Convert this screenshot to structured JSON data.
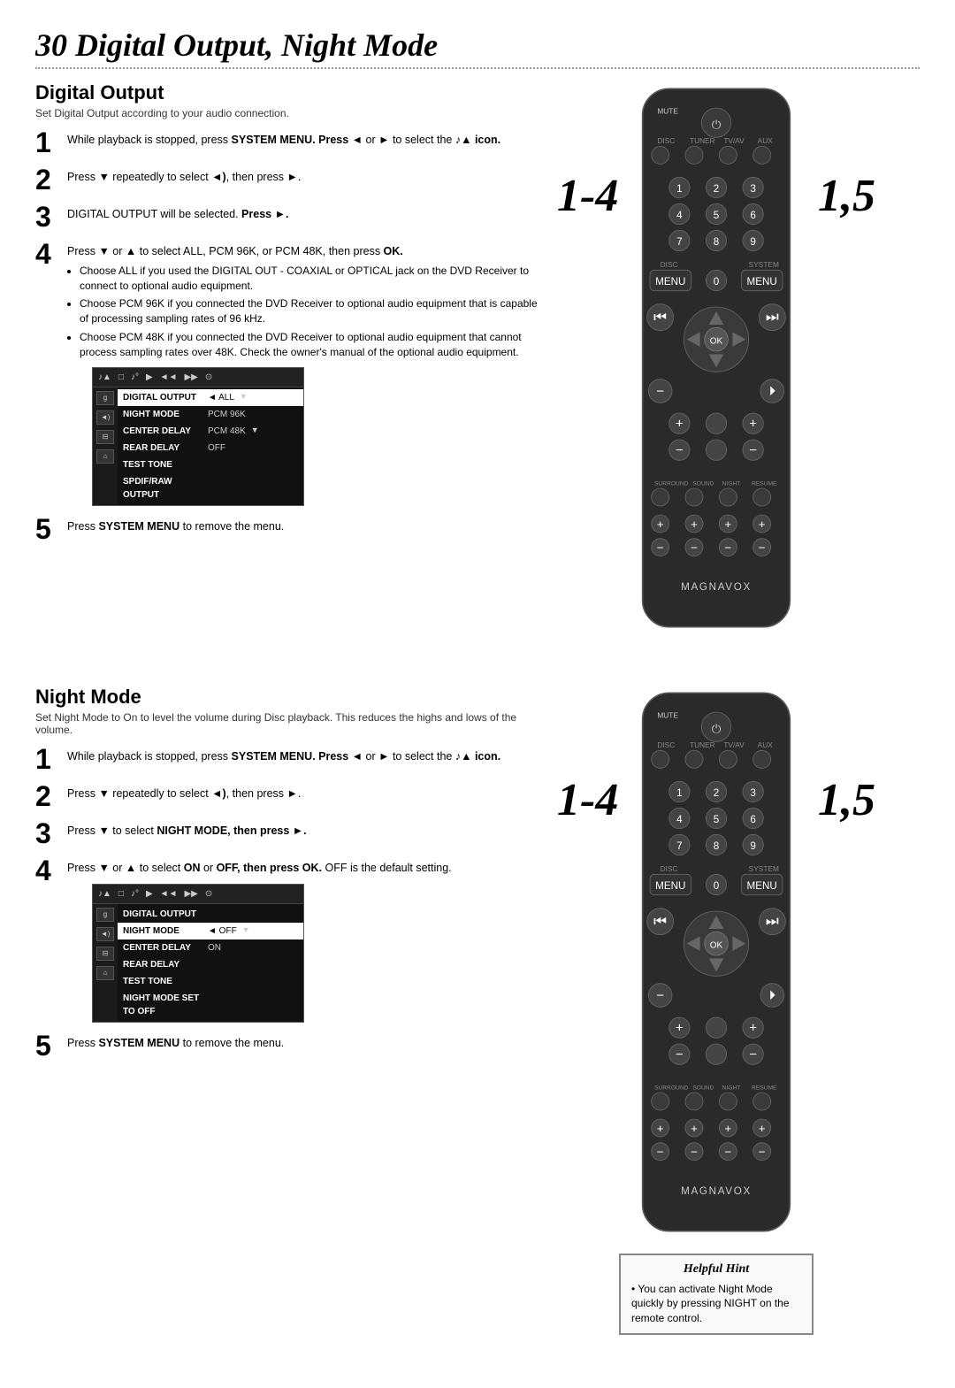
{
  "page": {
    "title": "30  Digital Output, Night Mode"
  },
  "digital_output": {
    "heading": "Digital Output",
    "description": "Set Digital Output according to your audio connection.",
    "steps": [
      {
        "num": "1",
        "html": "While playback is stopped, press <b>SYSTEM MENU. Press ◄</b> or <b>►</b> to select the <b>♪▲ icon.</b>"
      },
      {
        "num": "2",
        "html": "Press <b>▼</b> repeatedly to select <b>◄)</b>, then press <b>►</b>."
      },
      {
        "num": "3",
        "html": "DIGITAL OUTPUT will be selected. <b>Press ►.</b>"
      },
      {
        "num": "4",
        "html": "Press <b>▼</b> or <b>▲</b> to select ALL, PCM 96K, or PCM 48K, then press <b>OK.</b>",
        "bullets": [
          "Choose ALL if you used the DIGITAL OUT - COAXIAL or OPTICAL jack on the DVD Receiver to connect to optional audio equipment.",
          "Choose PCM 96K if you connected the DVD Receiver to optional audio equipment that is capable of processing sampling rates of 96 kHz.",
          "Choose PCM 48K if you connected the DVD Receiver to optional audio equipment that cannot process sampling rates over 48K. Check the owner's manual of the optional audio equipment."
        ]
      },
      {
        "num": "5",
        "html": "Press <b>SYSTEM MENU</b> to remove the menu."
      }
    ],
    "menu": {
      "top_icons": [
        "♪▲",
        "□",
        "♪°",
        "▶",
        "◄◄",
        "▶▶",
        "⊙"
      ],
      "left_icons": [
        "g",
        "◄)",
        "⊟",
        "⌂"
      ],
      "rows": [
        {
          "label": "DIGITAL OUTPUT",
          "value": "◄ ALL",
          "arrow": "▼",
          "highlight": true
        },
        {
          "label": "NIGHT MODE",
          "value": "PCM 96K",
          "arrow": "",
          "highlight": false
        },
        {
          "label": "CENTER DELAY",
          "value": "PCM 48K",
          "arrow": "▼",
          "highlight": false
        },
        {
          "label": "REAR DELAY",
          "value": "OFF",
          "arrow": "",
          "highlight": false
        },
        {
          "label": "TEST TONE",
          "value": "",
          "arrow": "",
          "highlight": false
        },
        {
          "label": "SPDIF/RAW OUTPUT",
          "value": "",
          "arrow": "",
          "highlight": false
        }
      ]
    }
  },
  "night_mode": {
    "heading": "Night Mode",
    "description": "Set Night Mode to On to level the volume during Disc playback. This reduces the highs and lows of the volume.",
    "steps": [
      {
        "num": "1",
        "html": "While playback is stopped, press <b>SYSTEM MENU. Press ◄</b> or <b>►</b> to select the <b>♪▲ icon.</b>"
      },
      {
        "num": "2",
        "html": "Press <b>▼</b> repeatedly to select <b>◄)</b>, then press <b>►</b>."
      },
      {
        "num": "3",
        "html": "Press <b>▼</b> to select <b>NIGHT MODE, then press ►.</b>"
      },
      {
        "num": "4",
        "html": "Press <b>▼</b> or <b>▲</b> to select <b>ON</b> or <b>OFF, then press OK.</b> OFF is the default setting."
      },
      {
        "num": "5",
        "html": "Press <b>SYSTEM MENU</b> to remove the menu."
      }
    ],
    "menu": {
      "top_icons": [
        "♪▲",
        "□",
        "♪°",
        "▶",
        "◄◄",
        "▶▶",
        "⊙"
      ],
      "left_icons": [
        "g",
        "◄)",
        "⊟",
        "⌂"
      ],
      "rows": [
        {
          "label": "DIGITAL OUTPUT",
          "value": "",
          "arrow": "",
          "highlight": false
        },
        {
          "label": "NIGHT MODE",
          "value": "◄ OFF",
          "arrow": "▼",
          "highlight": true
        },
        {
          "label": "CENTER DELAY",
          "value": "ON",
          "arrow": "",
          "highlight": false
        },
        {
          "label": "REAR DELAY",
          "value": "",
          "arrow": "",
          "highlight": false
        },
        {
          "label": "TEST TONE",
          "value": "",
          "arrow": "",
          "highlight": false
        },
        {
          "label": "NIGHT MODE SET TO OFF",
          "value": "",
          "arrow": "",
          "highlight": false
        }
      ]
    },
    "helpful_hint": {
      "title": "Helpful Hint",
      "text": "You can activate Night Mode quickly by pressing NIGHT on the remote control."
    }
  },
  "badge_left": "1-4",
  "badge_right": "1,5",
  "magnavox_label": "MAGNAVOX"
}
